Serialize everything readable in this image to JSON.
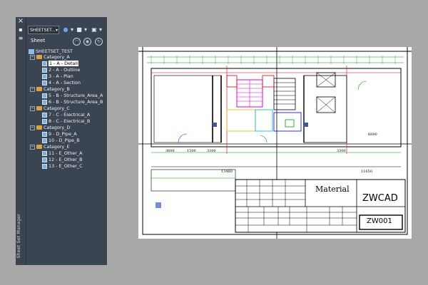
{
  "palette": {
    "strip_title": "Sheet Set Manager",
    "close_icon": "×",
    "sheetset_select": "SHEETSET...",
    "tab_label": "Sheet"
  },
  "tree": {
    "root": "SHEETSET_TEST",
    "nodes": [
      {
        "label": "Catagory_A",
        "type": "folder"
      },
      {
        "label": "1 - A - Detail",
        "type": "sheet",
        "selected": true
      },
      {
        "label": "2 - A - Outline",
        "type": "sheet"
      },
      {
        "label": "3 - A - Plan",
        "type": "sheet"
      },
      {
        "label": "4 - A - Section",
        "type": "sheet"
      },
      {
        "label": "Catagory_B",
        "type": "folder"
      },
      {
        "label": "5 - B - Structure_Area_A",
        "type": "sheet"
      },
      {
        "label": "6 - B - Structure_Area_B",
        "type": "sheet"
      },
      {
        "label": "Catagory_C",
        "type": "folder"
      },
      {
        "label": "7 - C - Electrical_A",
        "type": "sheet"
      },
      {
        "label": "8 - C - Electrical_B",
        "type": "sheet"
      },
      {
        "label": "Catagory_D",
        "type": "folder"
      },
      {
        "label": "9 - D_Pipe_A",
        "type": "sheet"
      },
      {
        "label": "10 - D_Pipe_B",
        "type": "sheet"
      },
      {
        "label": "Catagory_E",
        "type": "folder"
      },
      {
        "label": "11 - E_Other_A",
        "type": "sheet"
      },
      {
        "label": "12 - E_Other_B",
        "type": "sheet"
      },
      {
        "label": "13 - E_Other_C",
        "type": "sheet"
      }
    ]
  },
  "titleblock": {
    "material": "Material",
    "company": "ZWCAD",
    "drawing_no": "ZW001",
    "dims": {
      "d3600": "3600",
      "d1500": "1500",
      "d3300": "3300",
      "d13460": "13460",
      "d11650": "11650",
      "d6890": "6890",
      "d3300b": "3300"
    }
  },
  "colors": {
    "panel_bg": "#3b4451",
    "workspace_bg": "#a8a8a8",
    "selection": "#ffffff",
    "folder": "#d9a440"
  }
}
